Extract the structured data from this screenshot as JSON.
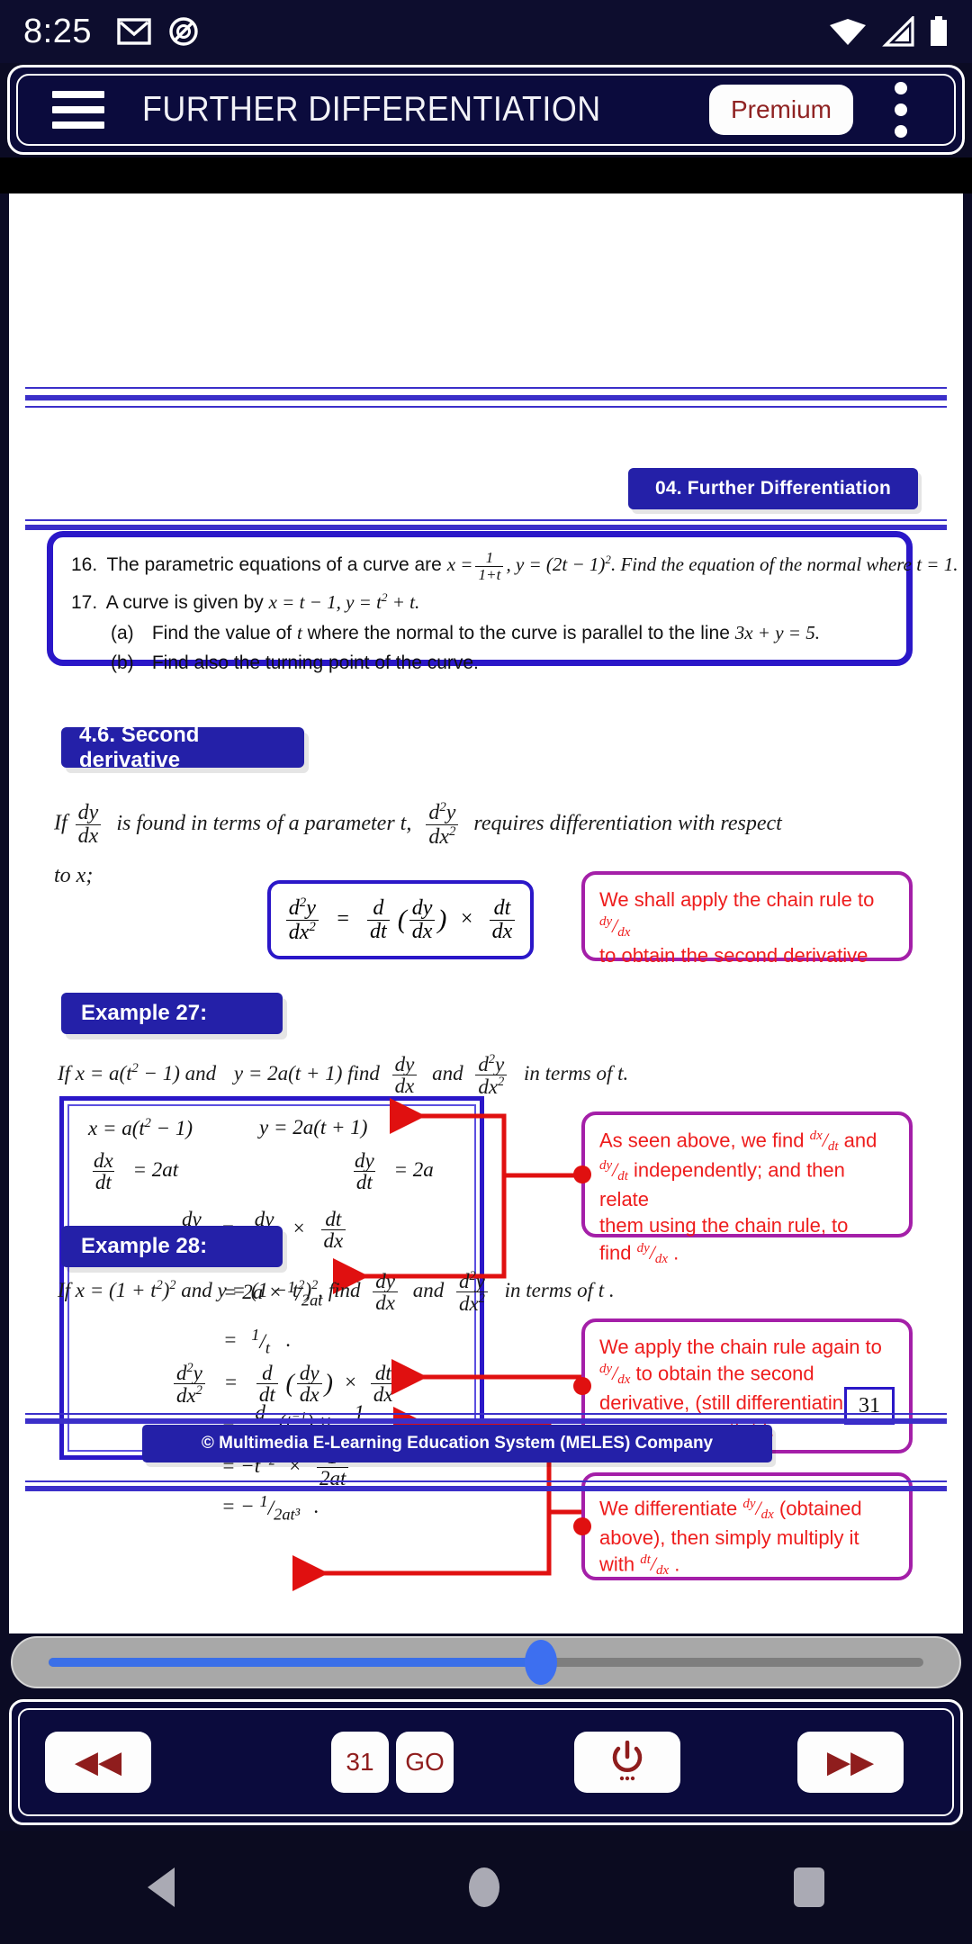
{
  "statusbar": {
    "time": "8:25",
    "icons_left": [
      "gmail-icon",
      "ring-slash-icon"
    ],
    "icons_right": [
      "wifi-icon",
      "signal-icon",
      "battery-icon"
    ]
  },
  "appbar": {
    "menu_icon": "hamburger-menu-icon",
    "title": "FURTHER DIFFERENTIATION",
    "premium_label": "Premium",
    "overflow_icon": "kebab-menu-icon",
    "bg_color": "#0b0b3d",
    "title_color": "#f2f2f7",
    "premium_text_color": "#8f2222"
  },
  "slide": {
    "chapter_tab": "04. Further Differentiation",
    "accent_color": "#2a17c8",
    "chip_color": "#2420a8",
    "callout_border_color": "#a41fa8",
    "callout_text_color": "#ee1c1c",
    "arrow_color": "#e01010",
    "questions": [
      {
        "num": "16.",
        "parts": [
          "The parametric equations of a curve are ",
          "x =",
          "1",
          "1+t",
          ", y = (2t − 1)",
          "2",
          ". Find the equation of the normal where t = 1."
        ],
        "text": "16. The parametric equations of a curve are x = 1/(1+t), y = (2t − 1)². Find the equation of the normal where t = 1."
      },
      {
        "num": "17.",
        "text": "17. A curve is given by x = t − 1, y = t² + t."
      },
      {
        "num": "(a)",
        "text": "(a) Find the value of t where the normal to the curve is parallel to the line 3x + y = 5."
      },
      {
        "num": "(b)",
        "text": "(b) Find also the turning point of the curve."
      }
    ],
    "q16_pre": "The parametric equations of a curve are",
    "q16_x_lhs": "x =",
    "q16_frac_num": "1",
    "q16_frac_den": "1+t",
    "q16_post": ", y = (2t − 1)",
    "q16_exp": "2",
    "q16_tail": ". Find the equation of the normal where t = 1.",
    "q17_text": "A curve is given by x = t − 1, y = t",
    "q17_exp": "2",
    "q17_tail": " + t.",
    "q17a_text": "Find the value of t where the normal to the curve is parallel to the line 3x + y = 5.",
    "q17b_text": "Find also the turning point of the curve.",
    "section_heading": "4.6. Second derivative",
    "intro_line1_a": "If",
    "intro_line1_b": "is found in terms of a parameter  t,",
    "intro_line1_c": "requires differentiation with respect",
    "intro_line2": "to  x;",
    "callout1_line1": "We shall apply the chain rule to",
    "callout1_line2": "to obtain the second derivative",
    "example27_label": "Example 27:",
    "example27_prompt_a": "If  x = a(t",
    "example27_prompt_b": " − 1) and",
    "example27_prompt_c": "y = 2a(t + 1)  find",
    "example27_prompt_d": "and",
    "example27_prompt_e": "in terms of  t.",
    "work": {
      "line_x": "x = a(t",
      "line_x_exp": "2",
      "line_x_tail": " − 1)",
      "line_y": "y = 2a(t + 1)",
      "dxdt_rhs": "=  2at",
      "dydt_rhs": "=  2a",
      "dydx_rhs_chain": "=",
      "step_2a": "=  2a ×",
      "step_2a_frac": "1/2at",
      "step_1t": "=",
      "step_1t_frac": "1/t",
      "step_1t_dot": ".",
      "d2_line_eq": "=",
      "step_tinv": "=",
      "step_tinv_body": "(t",
      "step_tinv_exp": "−1",
      "step_tinv_close": ")  ×",
      "step_neg": "=  −t",
      "step_neg_exp": "−2",
      "step_neg_times": "×",
      "step_final": "=  −",
      "step_final_frac": "1/2at³",
      "step_final_dot": "."
    },
    "callout2_l1": "As seen above, we find",
    "callout2_l1b": "and",
    "callout2_l2b": "independently; and then relate",
    "callout2_l3": "them using the chain rule, to",
    "callout2_l4": "find",
    "callout3_l1": "We apply the chain rule again to",
    "callout3_l2b": "to obtain the second",
    "callout3_l3": "derivative, (still differentiating",
    "callout3_l4": "expressions with  t ).",
    "callout4_l1": "We differentiate",
    "callout4_l1b": "(obtained",
    "callout4_l2": "above), then simply multiply it",
    "callout4_l3": "with",
    "example28_label": "Example 28:",
    "example28_prompt_a": "If   x = (1 + t",
    "example28_prompt_b": ")",
    "example28_prompt_c": "and  y = (1 − t",
    "example28_prompt_d": ",  find",
    "example28_prompt_e": "and",
    "example28_prompt_f": "in terms of t .",
    "page_number": "31",
    "copyright": "© Multimedia E-Learning Education System (MELES) Company"
  },
  "seekbar": {
    "progress_percent": 56,
    "fill_color": "#3a6fe8",
    "thumb_color": "#3d6ff0",
    "track_color": "#7e7e7e"
  },
  "bottom_nav": {
    "rewind_icon": "rewind-icon",
    "rewind_glyph": "◀◀",
    "page_value": "31",
    "go_label": "GO",
    "power_icon": "power-icon",
    "forward_icon": "fast-forward-icon",
    "forward_glyph": "▶▶"
  },
  "system_nav": {
    "back_icon": "back-triangle-icon",
    "home_icon": "home-circle-icon",
    "recent_icon": "recents-square-icon"
  }
}
